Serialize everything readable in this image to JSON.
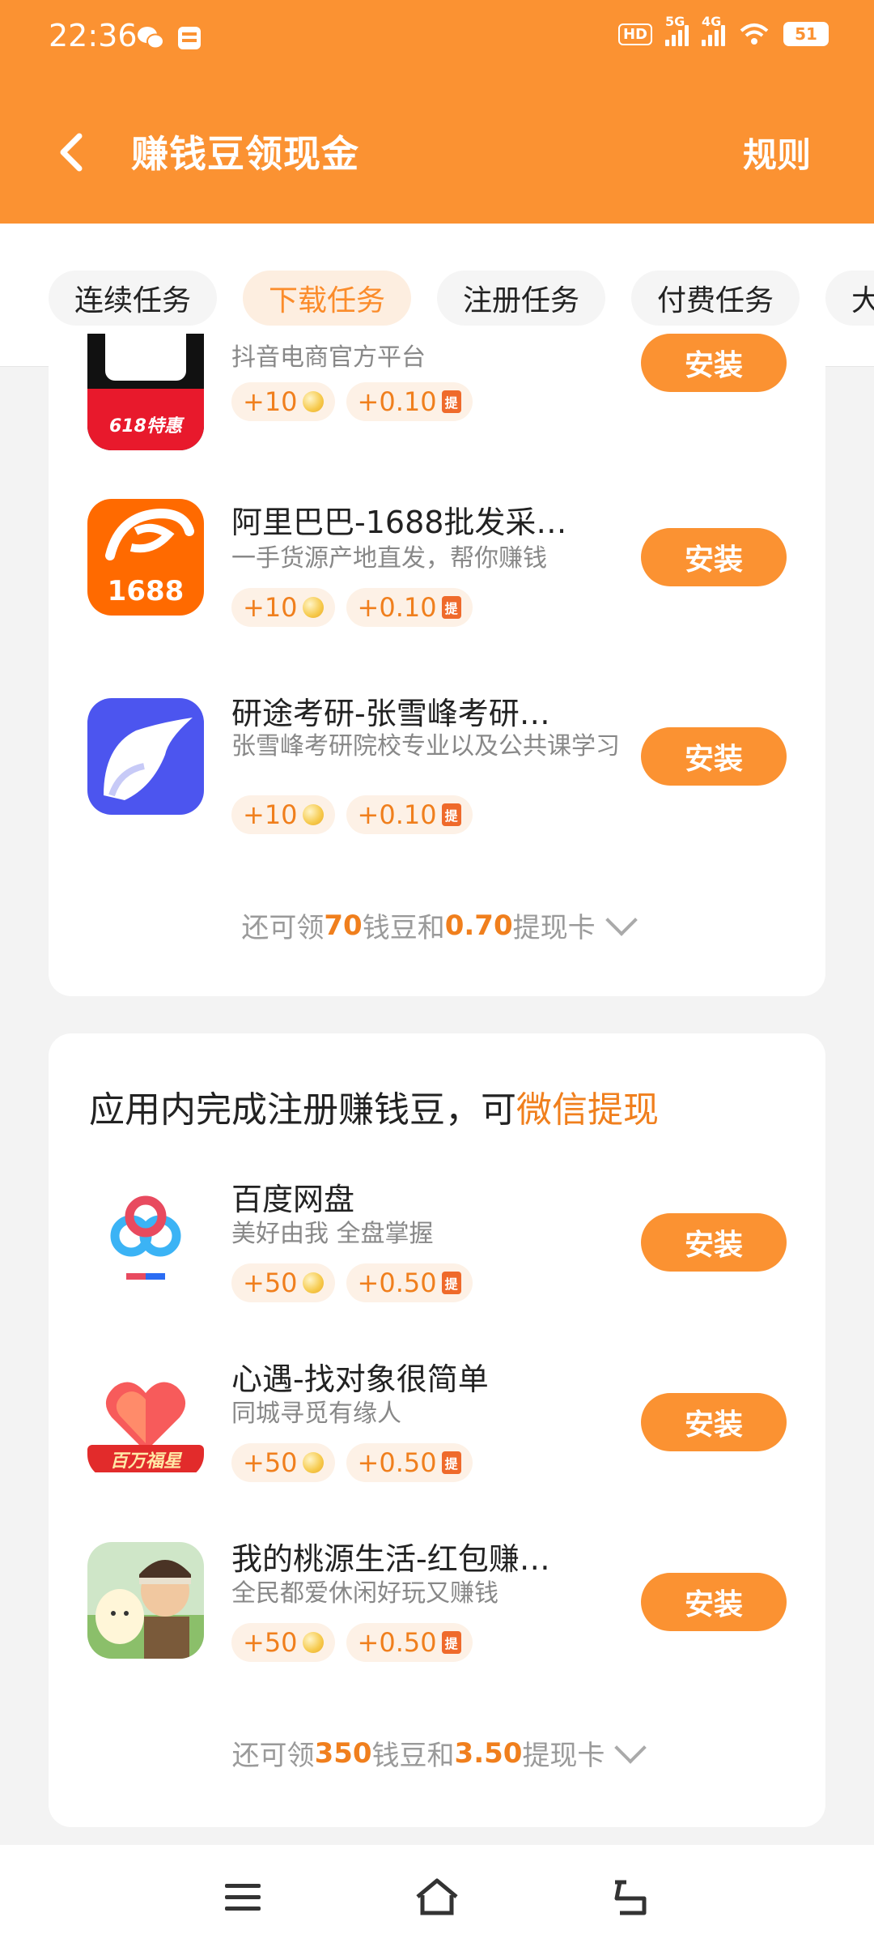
{
  "status_bar": {
    "time": "22:36",
    "hd_label": "HD",
    "net1": "5G",
    "net2": "4G",
    "battery": "51"
  },
  "header": {
    "title": "赚钱豆领现金",
    "rules_label": "规则"
  },
  "tabs": [
    {
      "label": "连续任务",
      "active": false
    },
    {
      "label": "下载任务",
      "active": true
    },
    {
      "label": "注册任务",
      "active": false
    },
    {
      "label": "付费任务",
      "active": false
    },
    {
      "label": "大",
      "active": false
    }
  ],
  "download_card": {
    "apps": [
      {
        "name": "",
        "desc": "抖音电商官方平台",
        "coins": "+10",
        "cash": "+0.10",
        "install": "安装",
        "icon_text": "618特惠"
      },
      {
        "name": "阿里巴巴-1688批发采…",
        "desc": "一手货源产地直发，帮你赚钱",
        "coins": "+10",
        "cash": "+0.10",
        "install": "安装",
        "icon_text": "1688"
      },
      {
        "name": "研途考研-张雪峰考研…",
        "desc": "张雪峰考研院校专业以及公共课学习",
        "coins": "+10",
        "cash": "+0.10",
        "install": "安装",
        "icon_text": ""
      }
    ],
    "footer": {
      "prefix": "还可领",
      "beans": "70",
      "mid": "钱豆和",
      "cash": "0.70",
      "suffix": "提现卡"
    }
  },
  "register_card": {
    "title": "应用内完成注册赚钱豆，可",
    "title_highlight": "微信提现",
    "apps": [
      {
        "name": "百度网盘",
        "desc": "美好由我 全盘掌握",
        "coins": "+50",
        "cash": "+0.50",
        "install": "安装"
      },
      {
        "name": "心遇-找对象很简单",
        "desc": "同城寻觅有缘人",
        "coins": "+50",
        "cash": "+0.50",
        "install": "安装",
        "icon_text": "百万福星"
      },
      {
        "name": "我的桃源生活-红包赚…",
        "desc": "全民都爱休闲好玩又赚钱",
        "coins": "+50",
        "cash": "+0.50",
        "install": "安装"
      }
    ],
    "footer": {
      "prefix": "还可领",
      "beans": "350",
      "mid": "钱豆和",
      "cash": "3.50",
      "suffix": "提现卡"
    }
  },
  "card_icon_glyph": "提",
  "colors": {
    "accent": "#fb9232",
    "highlight": "#f07f1d"
  }
}
